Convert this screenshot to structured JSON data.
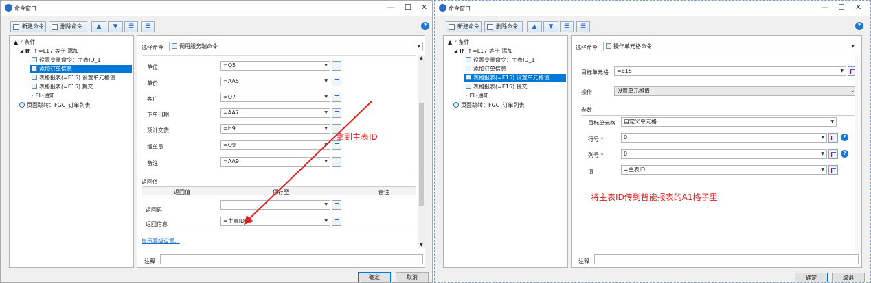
{
  "left": {
    "title": "命令窗口",
    "toolbar": {
      "new_cmd": "新建命令",
      "delete_cmd": "删除命令",
      "up": "▲",
      "down": "▼"
    },
    "tree": [
      {
        "text": "条件"
      },
      {
        "text": "If  =L17 等于 添加"
      },
      {
        "text": "设置变量命令：主表ID_1"
      },
      {
        "text": "添加订单信息"
      },
      {
        "text": "表格报表(=E15).设置单元格值"
      },
      {
        "text": "表格报表(=E15).提交"
      },
      {
        "text": "EL-通知"
      },
      {
        "text": "页面跳转：FGC_订单列表"
      }
    ],
    "select_label": "选择命令:",
    "select_value": "调用服务端命令",
    "params": [
      {
        "label": "单位",
        "value": "=Q5"
      },
      {
        "label": "单价",
        "value": "=AA5"
      },
      {
        "label": "客户",
        "value": "=Q7"
      },
      {
        "label": "下单日期",
        "value": "=AA7"
      },
      {
        "label": "预计交货",
        "value": "=H9"
      },
      {
        "label": "报单员",
        "value": "=Q9"
      },
      {
        "label": "备注",
        "value": "=AA9"
      }
    ],
    "return_title": "返回值",
    "return_headers": [
      "返回值",
      "保存至",
      "备注"
    ],
    "returns": [
      {
        "label": "返回码",
        "value": ""
      },
      {
        "label": "返回信息",
        "value": "=主表ID"
      }
    ],
    "advanced_link": "显示高级设置...",
    "note_label": "注释",
    "ok": "确定",
    "cancel": "取消",
    "annotation": "拿到主表ID"
  },
  "right": {
    "title": "命令窗口",
    "toolbar": {
      "new_cmd": "新建命令",
      "delete_cmd": "删除命令",
      "up": "▲",
      "down": "▼"
    },
    "tree": [
      {
        "text": "条件"
      },
      {
        "text": "If  =L17 等于 添加"
      },
      {
        "text": "设置变量命令：主表ID_1"
      },
      {
        "text": "添加订单信息"
      },
      {
        "text": "表格报表(=E15).设置单元格值"
      },
      {
        "text": "表格报表(=E15).提交"
      },
      {
        "text": "EL-通知"
      },
      {
        "text": "页面跳转：FGC_订单列表"
      }
    ],
    "select_label": "选择命令:",
    "select_value": "操作单元格命令",
    "target_label": "目标单元格",
    "target_value": "=E15",
    "op_label": "操作",
    "op_value": "设置单元格值",
    "params_title": "参数",
    "sub_target_label": "目标单元格",
    "sub_target_value": "自定义单元格",
    "row_label": "行号",
    "row_value": "0",
    "col_label": "列号",
    "col_value": "0",
    "val_label": "值",
    "val_value": "=主表ID",
    "required_mark": "*",
    "annotation": "将主表ID传到智能报表的A1格子里",
    "note_label": "注释",
    "ok": "确定",
    "cancel": "取消"
  },
  "colors": {
    "selection": "#0078d7",
    "annotation": "#e02020",
    "help": "#1e78d2"
  }
}
